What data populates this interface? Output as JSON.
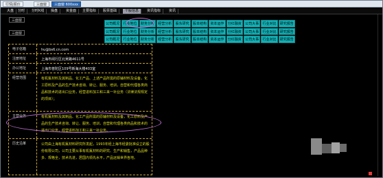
{
  "title_tabs": [
    "行情|报价",
    "三面窗",
    "三面窗 600xxx"
  ],
  "menu": [
    "大盘",
    "分时",
    "分时K线",
    "操盘",
    "资金面",
    "主要指标",
    "股票基础",
    "个股信息",
    "资讯指标",
    "资讯"
  ],
  "left_tabs": [
    "三面窗",
    "三面窗"
  ],
  "nav_cells": [
    "公司概况",
    "行业地位",
    "财务分析",
    "经营分析",
    "股东研究",
    "股本结构",
    "资本运作",
    "分红融资",
    "公司大事",
    "行业对比",
    "研究报告",
    "公司概况",
    "行业地位",
    "财务分析",
    "经营分析",
    "股东研究",
    "股本结构",
    "资本运作",
    "分红融资",
    "公司大事",
    "行业对比",
    "研究报告",
    "公司概况",
    "行业地位",
    "财务分析",
    "经营分析",
    "股东研究",
    "股本结构",
    "资本运作",
    "分红融资",
    "公司大事",
    "行业对比",
    "研究报告"
  ],
  "table": [
    {
      "label": "电子信箱",
      "value": "hu@bs6.cn.com"
    },
    {
      "label": "注册地址",
      "value": "上海市闵行区北吴路4611号"
    },
    {
      "label": "办公地址",
      "value": "上海市普陀区109号新海大楼403室"
    },
    {
      "label": "经营范围",
      "value": "有机氟材料及其制品、化工产品、上述产品所需的原辅材料及设备，化工原料及产品的生产技术咨询、转让、服务、培训，自营和代理各类商品和技术的进出口业务，经营进料加工和三来一补业务（法律法规规定的项目）；"
    },
    {
      "label": "主营业务",
      "value": "有机氟材料及其制品、化工产品所需的原辅材料及设备，化工原料及产品的生产技术咨询、转让、服务、培训，自营和代理各类商品和技术的进出口业务，经营进料加工和三来一补业务。"
    },
    {
      "label": "历史沿革",
      "value": "公司由上海有机氟材料研究所发起，1993年经上海市经委批准设立的股份有限公司，公司主要从事有机氟材料的研究、生产和销售，产品品种多、规格全，技术先进，居国内领先水平，产品远销世界各地。"
    }
  ],
  "colors": {
    "accent_tab": "#2b66b0",
    "nav_cell": "#13b3b8",
    "oval": "#c272d6",
    "table_border": "#c9a83a",
    "yellow_text": "#dede1e"
  }
}
